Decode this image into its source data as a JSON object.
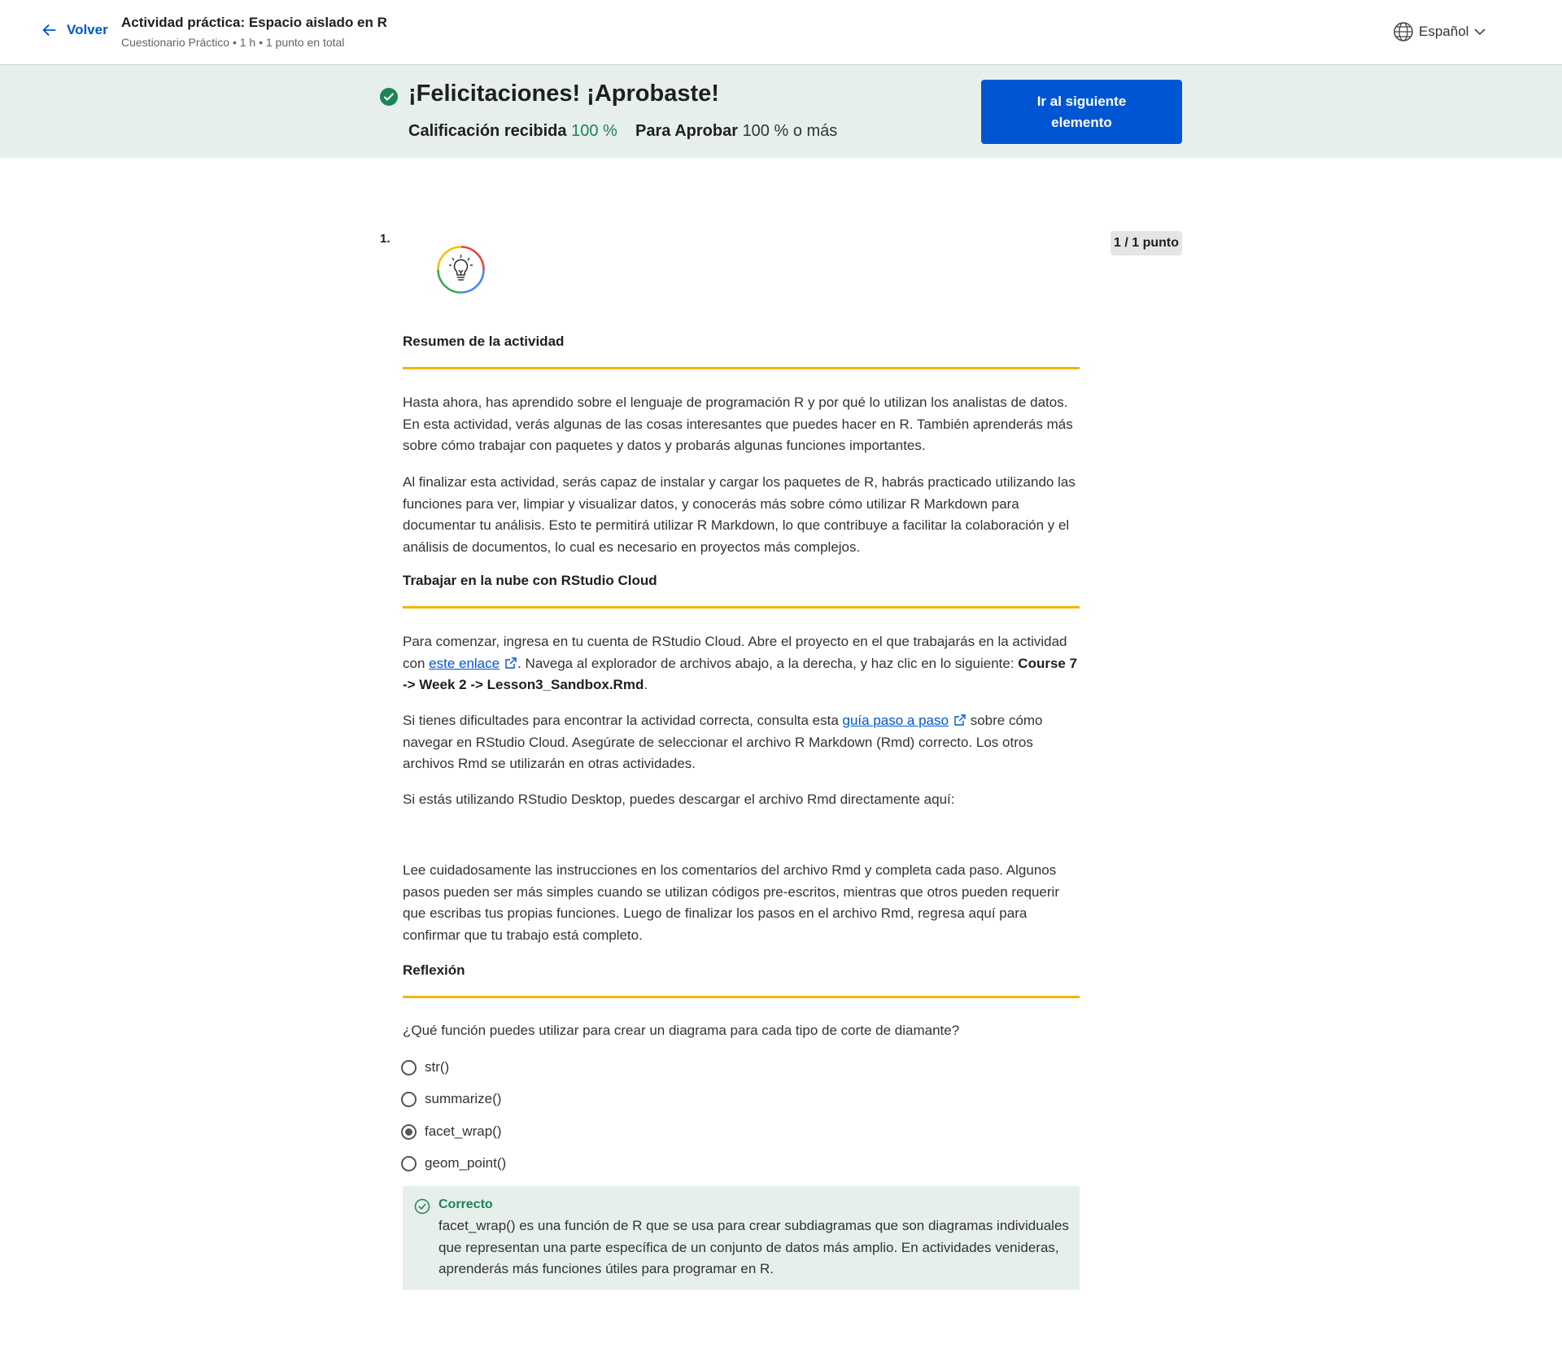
{
  "header": {
    "back_label": "Volver",
    "title": "Actividad práctica: Espacio aislado en R",
    "subtitle": "Cuestionario Práctico • 1 h • 1 punto en total",
    "language": "Español"
  },
  "banner": {
    "heading": "¡Felicitaciones! ¡Aprobaste!",
    "grade_label": "Calificación recibida",
    "grade_value": "100 %",
    "pass_label": "Para Aprobar",
    "pass_value": "100 %",
    "pass_suffix": "o más",
    "next_button": "Ir al siguiente elemento"
  },
  "question": {
    "number": "1.",
    "points": "1 / 1 punto",
    "sections": {
      "summary_title": "Resumen de la actividad",
      "summary_p1": "Hasta ahora, has aprendido sobre el lenguaje de programación R y por qué lo utilizan los analistas de datos. En esta actividad, verás algunas de las cosas interesantes que puedes hacer en R. También aprenderás más sobre cómo trabajar con paquetes y datos y probarás algunas funciones importantes.",
      "summary_p2": "Al finalizar esta actividad, serás capaz de instalar y cargar los paquetes de R, habrás practicado utilizando las funciones para ver, limpiar y visualizar datos, y conocerás más sobre cómo utilizar R Markdown para documentar tu análisis. Esto te permitirá utilizar R Markdown, lo que contribuye a facilitar la colaboración y el análisis de documentos, lo cual es necesario en proyectos más complejos.",
      "cloud_title": "Trabajar en la nube con RStudio Cloud",
      "cloud_p1_a": "Para comenzar, ingresa en tu cuenta de RStudio Cloud. Abre el proyecto en el que trabajarás en la actividad con ",
      "cloud_p1_link": "este enlace",
      "cloud_p1_b": ". Navega al explorador de archivos abajo, a la derecha, y haz clic en lo siguiente: ",
      "cloud_p1_bold": "Course 7 -> Week 2 -> Lesson3_Sandbox.Rmd",
      "cloud_p1_end": ".",
      "cloud_p2_a": "Si tienes dificultades para encontrar la actividad correcta, consulta esta ",
      "cloud_p2_link": "guía paso a paso",
      "cloud_p2_b": " sobre cómo navegar en RStudio Cloud. Asegúrate de seleccionar el archivo R Markdown (Rmd) correcto. Los otros archivos Rmd se utilizarán en otras actividades.",
      "cloud_p3": "Si estás utilizando RStudio Desktop, puedes descargar el archivo Rmd directamente aquí:",
      "cloud_p4": "Lee cuidadosamente las instrucciones en los comentarios del archivo Rmd y completa cada paso. Algunos pasos pueden ser más simples cuando se utilizan códigos pre-escritos, mientras que otros pueden requerir que escribas tus propias funciones. Luego de finalizar los pasos en el archivo Rmd, regresa aquí para confirmar que tu trabajo está completo.",
      "reflection_title": "Reflexión",
      "prompt": "¿Qué función puedes utilizar para crear un diagrama para cada tipo de corte de diamante?"
    },
    "options": [
      {
        "label": "str()",
        "selected": false
      },
      {
        "label": "summarize()",
        "selected": false
      },
      {
        "label": "facet_wrap()",
        "selected": true
      },
      {
        "label": "geom_point()",
        "selected": false
      }
    ],
    "feedback": {
      "title": "Correcto",
      "text": "facet_wrap() es una función de R que se usa para crear subdiagramas que son diagramas individuales que representan una parte específica de un conjunto de datos más amplio. En actividades venideras, aprenderás más funciones útiles para programar en R."
    }
  },
  "colors": {
    "accent": "#0056d2",
    "success": "#1f8354",
    "banner_bg": "#e6efec",
    "rule": "#f4b400"
  },
  "icons": [
    "arrow-left-icon",
    "globe-icon",
    "chevron-down-icon",
    "check-circle-icon",
    "lightbulb-icon",
    "external-link-icon",
    "check-outline-icon"
  ]
}
